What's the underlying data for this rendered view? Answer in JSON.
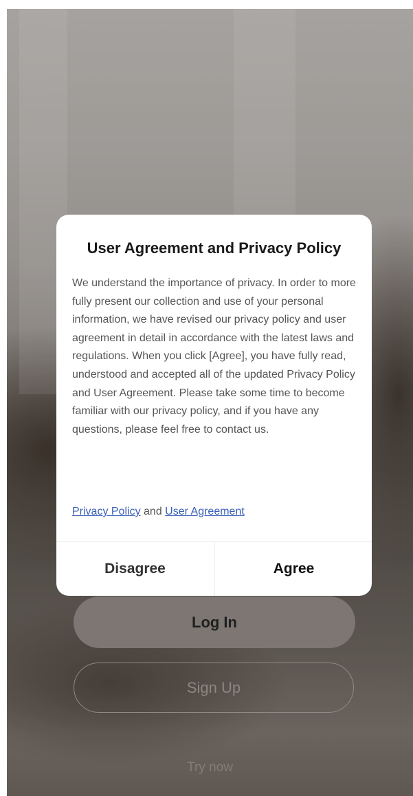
{
  "background_screen": {
    "login_label": "Log In",
    "signup_label": "Sign Up",
    "try_now_label": "Try now"
  },
  "dialog": {
    "title": "User Agreement and Privacy Policy",
    "body": "We understand the importance of privacy. In order to more fully present our collection and use of your personal information, we have revised our privacy policy and user agreement in detail in accordance with the latest laws and regulations. When you click [Agree], you have fully read, understood and accepted all of the updated Privacy Policy and User Agreement. Please take some time to become familiar with our privacy policy, and if you have any questions, please feel free to contact us.",
    "privacy_link": "Privacy Policy",
    "and_text": "and",
    "user_agreement_link": "User Agreement",
    "disagree_label": "Disagree",
    "agree_label": "Agree"
  },
  "colors": {
    "link": "#3a5fb8",
    "dialog_background": "#ffffff",
    "login_button": "#7d7672"
  }
}
